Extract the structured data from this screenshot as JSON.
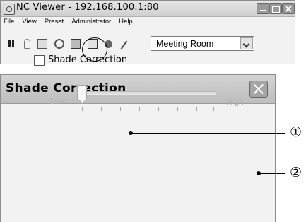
{
  "nc_viewer": {
    "title": "NC Viewer - 192.168.100.1:80",
    "menu": [
      "File",
      "View",
      "Preset",
      "Administrator",
      "Help"
    ],
    "toolbar_icons": [
      "pause-icon",
      "microphone-icon",
      "window-icon",
      "gear-icon",
      "camera-icon",
      "shade-correction-icon",
      "sound-icon",
      "wrench-icon"
    ],
    "preset_select": {
      "value": "Meeting Room"
    }
  },
  "dialog": {
    "title": "Shade Correction",
    "checkbox": {
      "label": "Shade Correction",
      "checked": false
    },
    "slider": {
      "low_label": "Low",
      "high_label": "High",
      "value": 0,
      "enabled": false,
      "tick_count": 8
    }
  },
  "callouts": [
    "①",
    "②"
  ]
}
